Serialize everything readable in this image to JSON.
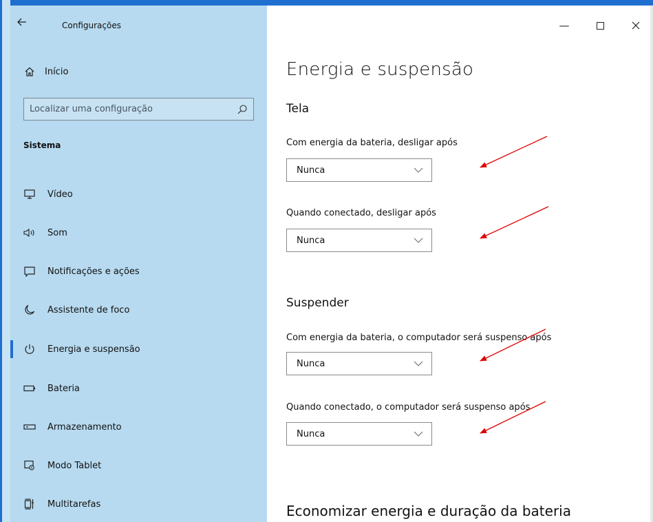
{
  "window": {
    "title": "Configurações",
    "back_icon": "back-arrow-icon",
    "controls": {
      "minimize": "—",
      "maximize": "☐",
      "close": "✕"
    }
  },
  "sidebar": {
    "home_label": "Início",
    "search_placeholder": "Localizar uma configuração",
    "section": "Sistema",
    "items": [
      {
        "label": "Vídeo",
        "icon": "monitor-icon"
      },
      {
        "label": "Som",
        "icon": "speaker-icon"
      },
      {
        "label": "Notificações e ações",
        "icon": "notification-icon"
      },
      {
        "label": "Assistente de foco",
        "icon": "moon-icon"
      },
      {
        "label": "Energia e suspensão",
        "icon": "power-icon",
        "active": true
      },
      {
        "label": "Bateria",
        "icon": "battery-icon"
      },
      {
        "label": "Armazenamento",
        "icon": "storage-icon"
      },
      {
        "label": "Modo Tablet",
        "icon": "tablet-mode-icon"
      },
      {
        "label": "Multitarefas",
        "icon": "multitasking-icon"
      }
    ]
  },
  "main": {
    "title": "Energia e suspensão",
    "screen": {
      "title": "Tela",
      "battery_label": "Com energia da bateria, desligar após",
      "battery_value": "Nunca",
      "plugged_label": "Quando conectado, desligar após",
      "plugged_value": "Nunca"
    },
    "sleep": {
      "title": "Suspender",
      "battery_label": "Com energia da bateria, o computador será suspenso após",
      "battery_value": "Nunca",
      "plugged_label": "Quando conectado, o computador será suspenso após",
      "plugged_value": "Nunca"
    },
    "bottom_section_title": "Economizar energia e duração da bateria"
  },
  "colors": {
    "accent": "#1f6fd0",
    "sidebar_bg": "#b7daf0",
    "annotation_arrow": "#e00000"
  }
}
